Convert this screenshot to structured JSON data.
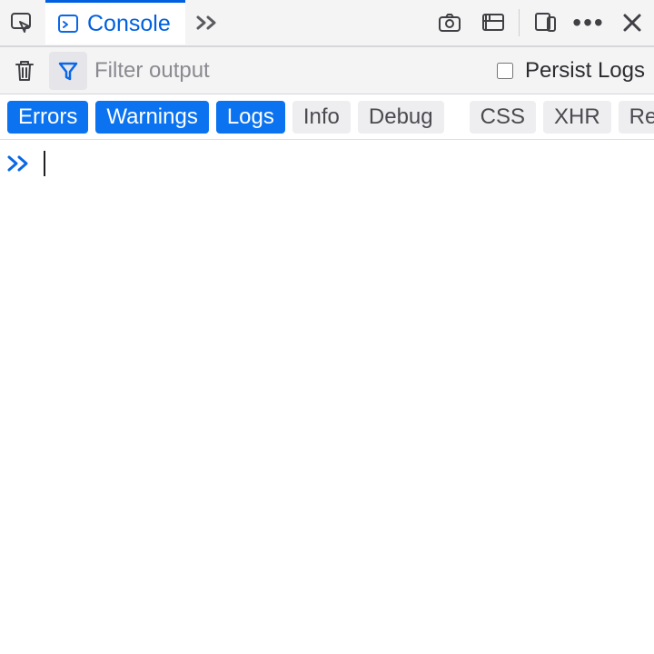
{
  "tabbar": {
    "active_tab_label": "Console"
  },
  "toolbar": {
    "filter_placeholder": "Filter output",
    "persist_label": "Persist Logs"
  },
  "filters": {
    "errors": "Errors",
    "warnings": "Warnings",
    "logs": "Logs",
    "info": "Info",
    "debug": "Debug",
    "css": "CSS",
    "xhr": "XHR",
    "requests": "Requests"
  },
  "console": {
    "input_value": ""
  }
}
